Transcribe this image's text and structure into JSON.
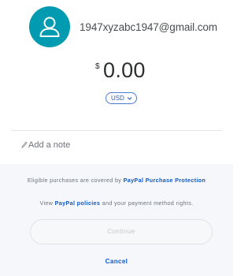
{
  "recipient": {
    "email": "1947xyzabc1947@gmail.com",
    "avatar_icon": "person-icon",
    "avatar_color": "#009bb0"
  },
  "amount": {
    "currency_symbol": "$",
    "value": "0.00"
  },
  "currency_selector": {
    "selected": "USD",
    "icon": "chevron-down-icon"
  },
  "note": {
    "icon": "pencil-icon",
    "placeholder": "Add a note"
  },
  "legal": {
    "line1_prefix": "Eligible purchases are covered by ",
    "line1_link": "PayPal Purchase Protection",
    "line2_prefix": "View ",
    "line2_link": "PayPal policies",
    "line2_suffix": " and your payment method rights."
  },
  "actions": {
    "continue_label": "Continue",
    "cancel_label": "Cancel"
  },
  "colors": {
    "link": "#0d57c9",
    "accent_teal": "#009bb0"
  }
}
